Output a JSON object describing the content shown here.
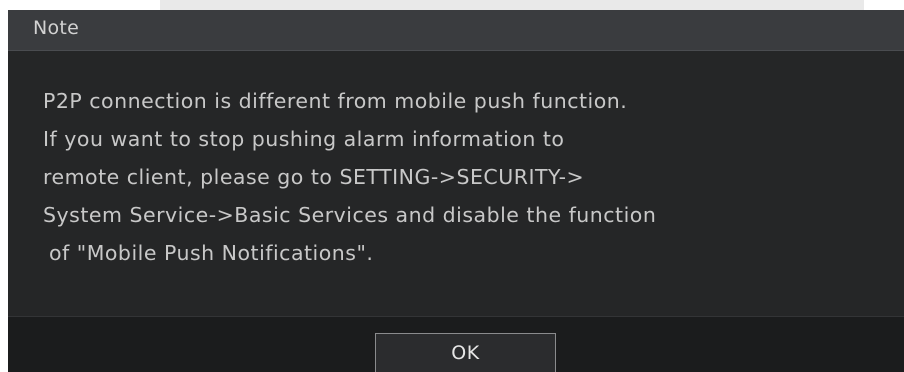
{
  "dialog": {
    "title": "Note",
    "message_lines": [
      "P2P connection is different from mobile push function.",
      "If you want to stop pushing alarm information to",
      "remote client, please go to SETTING->SECURITY->",
      "System Service->Basic Services and disable the function",
      "of \"Mobile Push Notifications\"."
    ],
    "ok_label": "OK"
  },
  "colors": {
    "dialog_background": "#252627",
    "titlebar_background": "#3a3c3f",
    "footer_background": "#1b1c1d",
    "text": "#c8c8c8"
  }
}
